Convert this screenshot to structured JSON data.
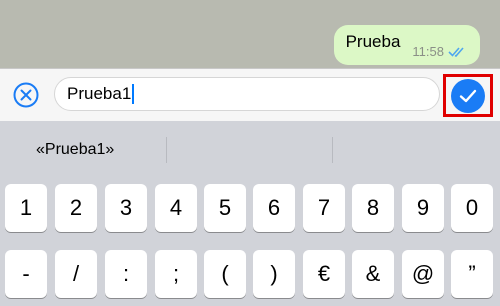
{
  "chat": {
    "message_text": "Prueba",
    "message_time": "11:58",
    "read_ticks": "double-check-icon",
    "bubble_color": "#dcf8c6"
  },
  "edit_bar": {
    "cancel_icon": "circle-x-icon",
    "input_value": "Prueba1",
    "confirm_icon": "checkmark-icon",
    "accent_color": "#1a7cf5",
    "highlight_color": "#e00000"
  },
  "predictive": {
    "suggestions": [
      "«Prueba1»",
      "",
      ""
    ]
  },
  "keyboard": {
    "row1": [
      "1",
      "2",
      "3",
      "4",
      "5",
      "6",
      "7",
      "8",
      "9",
      "0"
    ],
    "row2": [
      "-",
      "/",
      ":",
      ";",
      "(",
      ")",
      "€",
      "&",
      "@",
      "”"
    ]
  }
}
